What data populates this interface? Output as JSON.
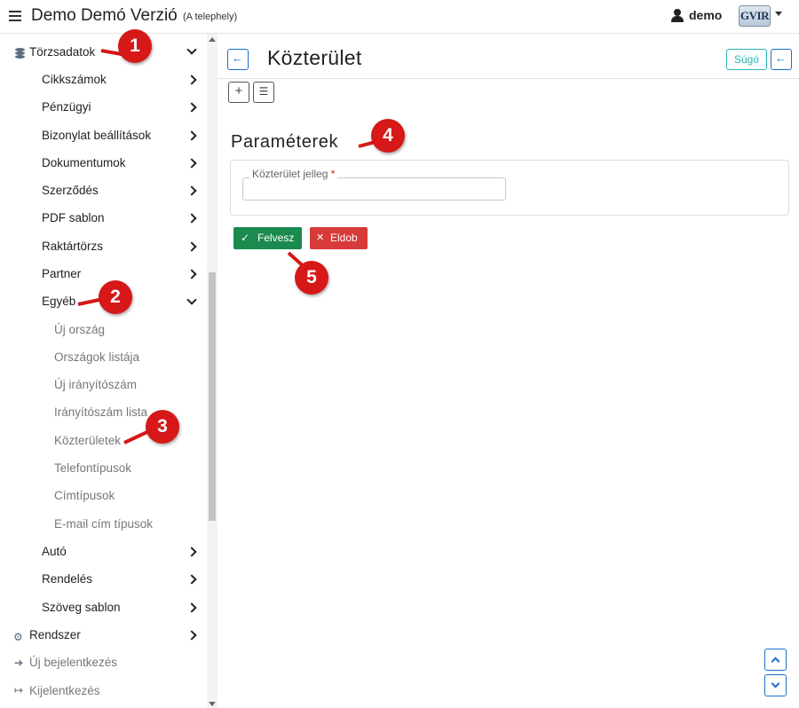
{
  "topbar": {
    "title": "Demo Demó Verzió",
    "subtitle": "(A telephely)",
    "user_name": "demo",
    "logo_text": "GVIR"
  },
  "sidebar": {
    "sections": [
      {
        "label": "Törzsadatok",
        "icon": "database-icon",
        "state": "expanded"
      },
      {
        "label": "Rendszer",
        "icon": "gears-icon",
        "state": "collapsed"
      }
    ],
    "items": [
      {
        "label": "Cikkszámok"
      },
      {
        "label": "Pénzügyi"
      },
      {
        "label": "Bizonylat beállítások"
      },
      {
        "label": "Dokumentumok"
      },
      {
        "label": "Szerződés"
      },
      {
        "label": "PDF sablon"
      },
      {
        "label": "Raktártörzs"
      },
      {
        "label": "Partner"
      },
      {
        "label": "Egyéb"
      },
      {
        "label": "Autó"
      },
      {
        "label": "Rendelés"
      },
      {
        "label": "Szöveg sablon"
      }
    ],
    "egyeb_sub": [
      {
        "label": "Új ország"
      },
      {
        "label": "Országok listája"
      },
      {
        "label": "Új irányítószám"
      },
      {
        "label": "Irányítószám lista"
      },
      {
        "label": "Közterületek"
      },
      {
        "label": "Telefontípusok"
      },
      {
        "label": "Címtípusok"
      },
      {
        "label": "E-mail cím típusok"
      }
    ],
    "login": "Új bejelentkezés",
    "logout": "Kijelentkezés"
  },
  "main": {
    "title": "Közterület",
    "help_label": "Súgó",
    "section_title": "Paraméterek",
    "field_label": "Közterület jelleg",
    "field_required_mark": "*",
    "field_value": "",
    "save_label": "Felvesz",
    "cancel_label": "Eldob"
  },
  "callouts": [
    "1",
    "2",
    "3",
    "4",
    "5"
  ],
  "colors": {
    "accent": "#1a6fc9",
    "callout": "#d61818",
    "save": "#1b8a4f",
    "cancel": "#d83a3a",
    "help": "#2cb5b5"
  }
}
